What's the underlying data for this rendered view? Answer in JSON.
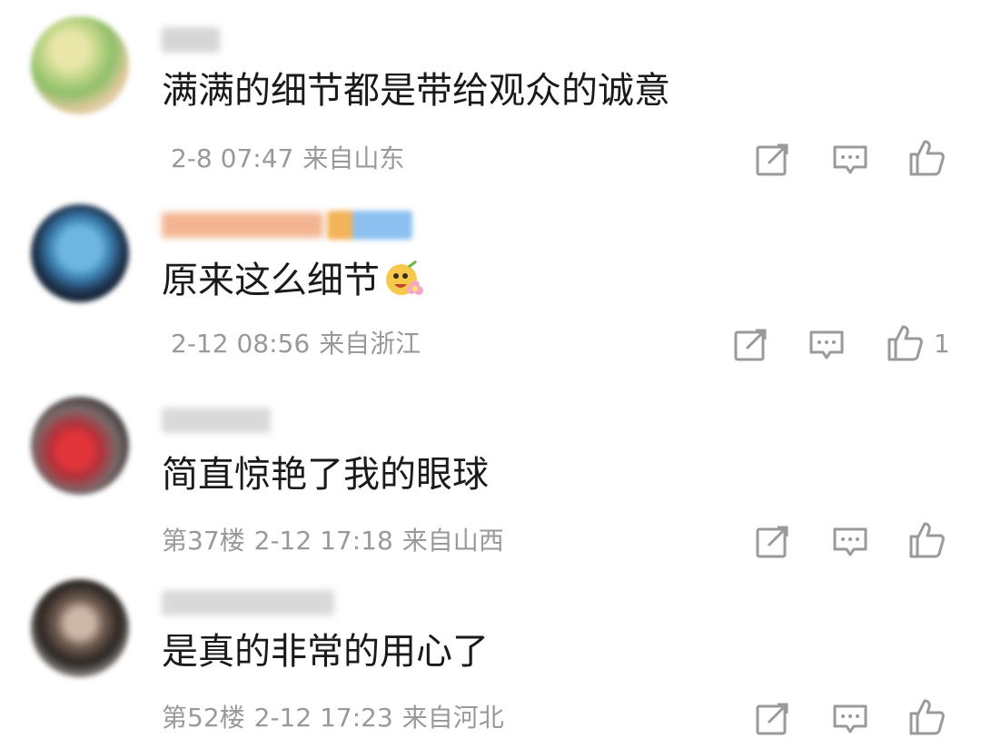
{
  "colors": {
    "text_primary": "#1a1a1a",
    "text_secondary": "#999999",
    "icon": "#9a9a9a",
    "username_accent": "#f0a27a",
    "badge_blue": "#7fb6ee"
  },
  "comments": [
    {
      "username": "",
      "text": "满满的细节都是带给观众的诚意",
      "floor": "",
      "time": "2-8 07:47",
      "location": "来自山东",
      "likes": "",
      "icons": [
        "share-icon",
        "reply-icon",
        "like-icon"
      ]
    },
    {
      "username": "",
      "text": "原来这么细节",
      "emoji": "flower-face-emoji",
      "floor": "",
      "time": "2-12 08:56",
      "location": "来自浙江",
      "likes": "1",
      "icons": [
        "share-icon",
        "reply-icon",
        "like-icon"
      ]
    },
    {
      "username": "",
      "text": "简直惊艳了我的眼球",
      "floor": "第37楼",
      "time": "2-12 17:18",
      "location": "来自山西",
      "likes": "",
      "icons": [
        "share-icon",
        "reply-icon",
        "like-icon"
      ]
    },
    {
      "username": "",
      "text": "是真的非常的用心了",
      "floor": "第52楼",
      "time": "2-12 17:23",
      "location": "来自河北",
      "likes": "",
      "icons": [
        "share-icon",
        "reply-icon",
        "like-icon"
      ]
    }
  ]
}
